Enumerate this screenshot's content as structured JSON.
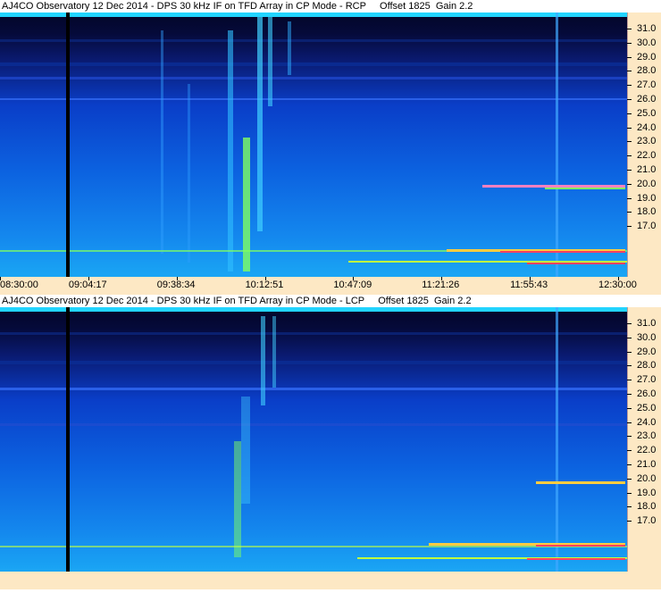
{
  "panels": [
    {
      "id": "rcp",
      "title": "AJ4CO Observatory 12 Dec 2014 - DPS 30 kHz IF on TFD Array in CP Mode - RCP     Offset 1825  Gain 2.2",
      "x_labels": [
        "08:30:00",
        "09:04:17",
        "09:38:34",
        "10:12:51",
        "10:47:09",
        "11:21:26",
        "11:55:43",
        "12:30:00"
      ]
    },
    {
      "id": "lcp",
      "title": "AJ4CO Observatory 12 Dec 2014 - DPS 30 kHz IF on TFD Array in CP Mode - LCP     Offset 1825  Gain 2.2",
      "x_labels": []
    }
  ],
  "y_labels": [
    "31.0",
    "30.0",
    "29.0",
    "28.0",
    "27.0",
    "26.0",
    "25.0",
    "24.0",
    "23.0",
    "22.0",
    "21.0",
    "20.0",
    "19.0",
    "18.0",
    "17.0"
  ],
  "colors": {
    "top_band": "#050a3a",
    "mid_band": "#0a3ec8",
    "low_band": "#1488ee",
    "bottom_band": "#1aa6f4",
    "burst": "#80ff60",
    "hot": "#ff4060",
    "axis_bg": "#fde8c4"
  }
}
